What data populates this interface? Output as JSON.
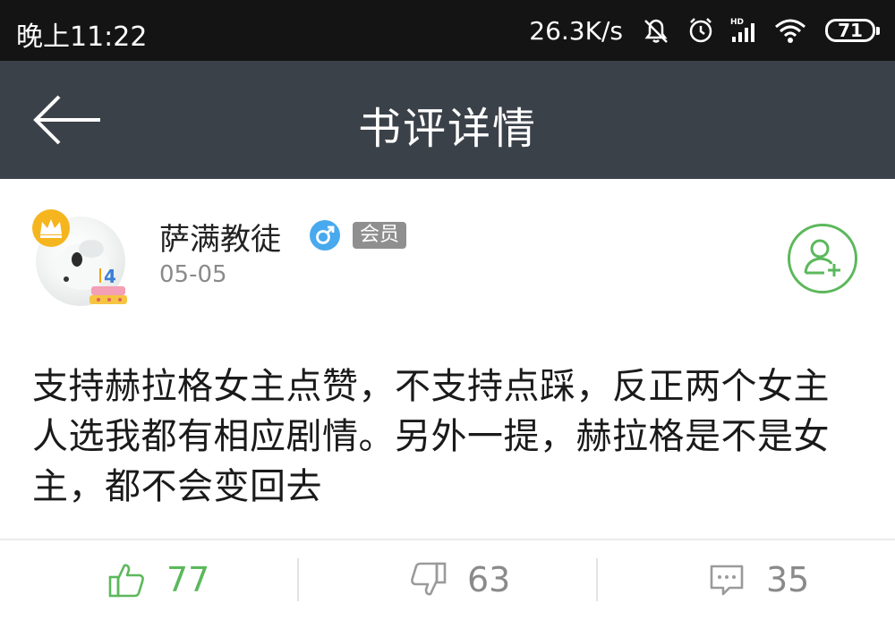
{
  "status_bar": {
    "time": "晚上11:22",
    "network_speed": "26.3K/s",
    "battery_level": "71",
    "icons": [
      "bell-muted-icon",
      "alarm-icon",
      "hd-signal-icon",
      "wifi-icon",
      "battery-icon"
    ]
  },
  "header": {
    "title": "书评详情",
    "back_icon": "arrow-left-icon"
  },
  "review": {
    "author": "萨满教徒",
    "gender_icon": "male-icon",
    "member_badge": "会员",
    "date": "05-05",
    "avatar_level": "4",
    "follow_icon": "add-user-icon",
    "content": "支持赫拉格女主点赞，不支持点踩，反正两个女主人选我都有相应剧情。另外一提，赫拉格是不是女主，都不会变回去"
  },
  "actions": {
    "likes": "77",
    "dislikes": "63",
    "comments": "35"
  },
  "colors": {
    "status_bar": "#141414",
    "header": "#3b4149",
    "like_green": "#5cb85c",
    "gray": "#8a8a8a",
    "gender_blue": "#49a9ee"
  }
}
